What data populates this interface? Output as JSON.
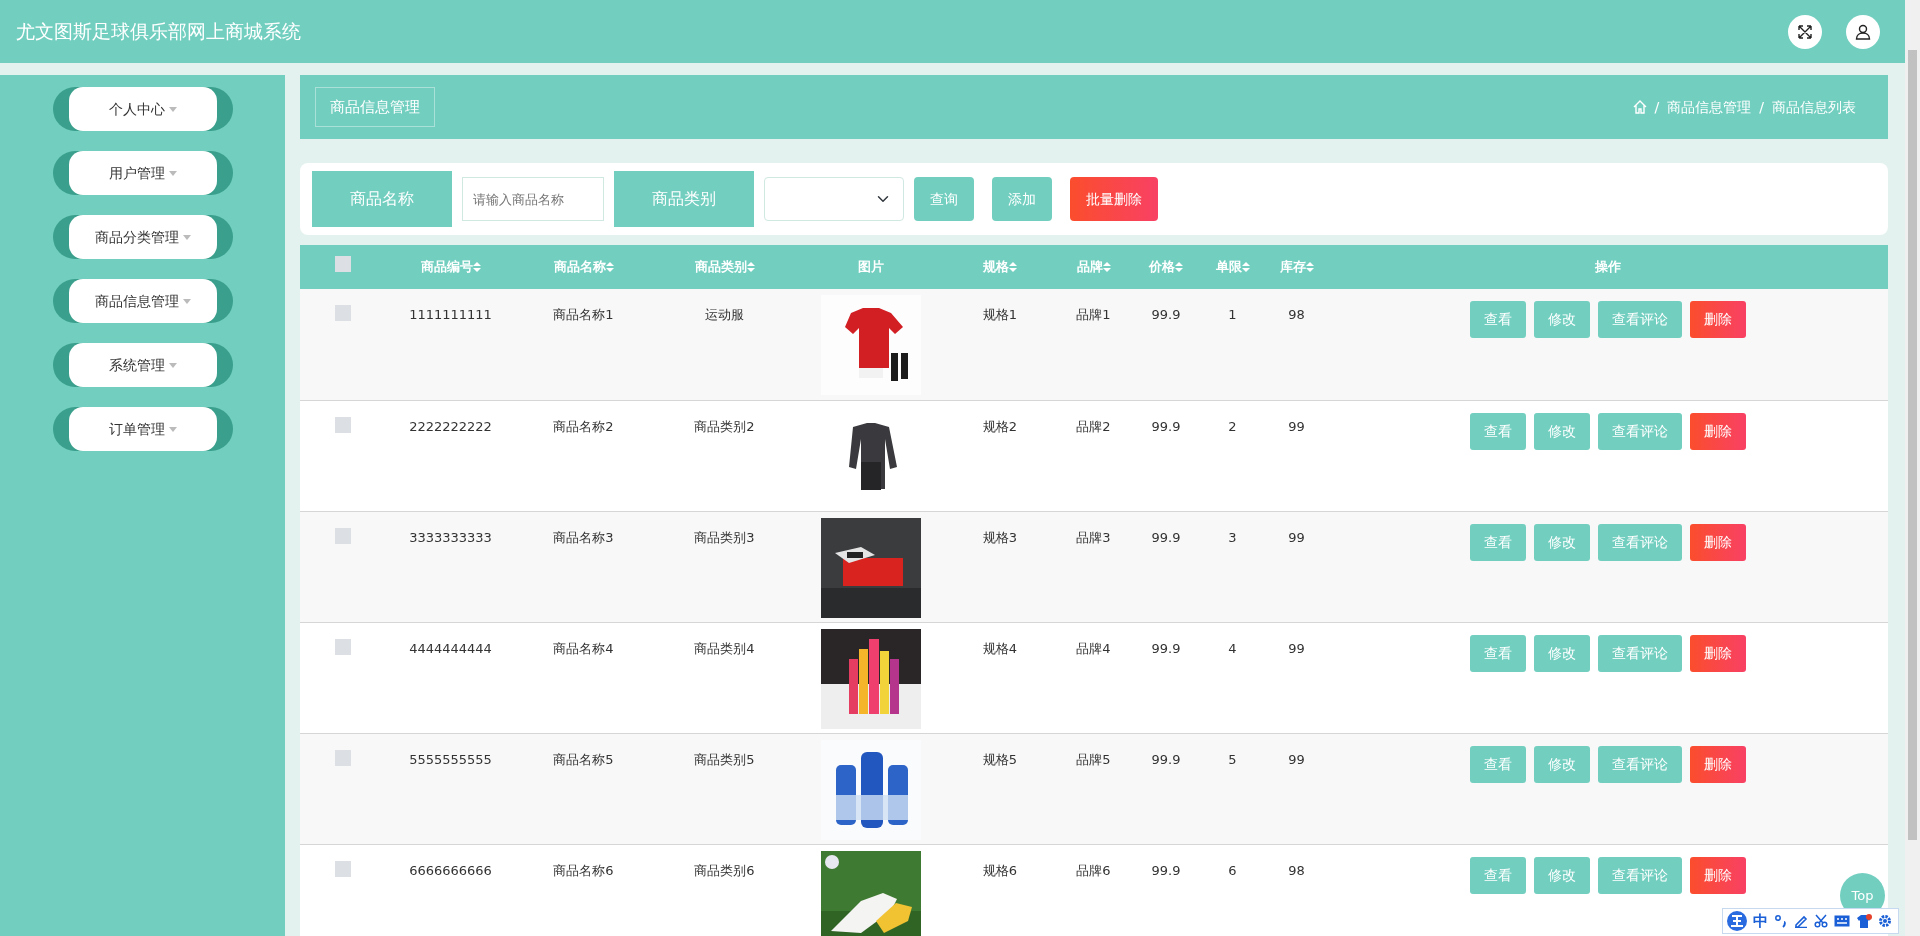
{
  "header": {
    "title": "尤文图斯足球俱乐部网上商城系统"
  },
  "sidebar": {
    "items": [
      {
        "label": "个人中心"
      },
      {
        "label": "用户管理"
      },
      {
        "label": "商品分类管理"
      },
      {
        "label": "商品信息管理"
      },
      {
        "label": "系统管理"
      },
      {
        "label": "订单管理"
      }
    ]
  },
  "page_title": "商品信息管理",
  "breadcrumb": [
    "/",
    "商品信息管理",
    "/",
    "商品信息列表"
  ],
  "search": {
    "fields": [
      {
        "label": "商品名称",
        "kind": "input",
        "placeholder": "请输入商品名称"
      },
      {
        "label": "商品类别",
        "kind": "select"
      }
    ],
    "buttons": [
      {
        "label": "查询",
        "kind": "plain"
      },
      {
        "label": "添加",
        "kind": "plain"
      },
      {
        "label": "批量删除",
        "kind": "danger"
      }
    ]
  },
  "table": {
    "select_all": {
      "checked": false
    },
    "columns": [
      {
        "label": "商品编号",
        "sortable": true
      },
      {
        "label": "商品名称",
        "sortable": true
      },
      {
        "label": "商品类别",
        "sortable": true
      },
      {
        "label": "图片",
        "sortable": false
      },
      {
        "label": "规格",
        "sortable": true
      },
      {
        "label": "品牌",
        "sortable": true
      },
      {
        "label": "价格",
        "sortable": true
      },
      {
        "label": "单限",
        "sortable": true
      },
      {
        "label": "库存",
        "sortable": true
      },
      {
        "label": "操作",
        "sortable": false
      }
    ],
    "rows": [
      {
        "checked": false,
        "cells": [
          "1111111111",
          "商品名称1",
          "运动服"
        ],
        "image": {
          "kind": "picture"
        },
        "cells2": [
          "规格1",
          "品牌1",
          "99.9",
          "1",
          "98"
        ],
        "actions": [
          {
            "label": "查看",
            "kind": "view"
          },
          {
            "label": "修改",
            "kind": "edit"
          },
          {
            "label": "查看评论",
            "kind": "comments"
          },
          {
            "label": "删除",
            "kind": "delete"
          }
        ]
      },
      {
        "checked": false,
        "cells": [
          "2222222222",
          "商品名称2",
          "商品类别2"
        ],
        "image": {
          "kind": "picture"
        },
        "cells2": [
          "规格2",
          "品牌2",
          "99.9",
          "2",
          "99"
        ],
        "actions": [
          {
            "label": "查看",
            "kind": "view"
          },
          {
            "label": "修改",
            "kind": "edit"
          },
          {
            "label": "查看评论",
            "kind": "comments"
          },
          {
            "label": "删除",
            "kind": "delete"
          }
        ]
      },
      {
        "checked": false,
        "cells": [
          "3333333333",
          "商品名称3",
          "商品类别3"
        ],
        "image": {
          "kind": "picture"
        },
        "cells2": [
          "规格3",
          "品牌3",
          "99.9",
          "3",
          "99"
        ],
        "actions": [
          {
            "label": "查看",
            "kind": "view"
          },
          {
            "label": "修改",
            "kind": "edit"
          },
          {
            "label": "查看评论",
            "kind": "comments"
          },
          {
            "label": "删除",
            "kind": "delete"
          }
        ]
      },
      {
        "checked": false,
        "cells": [
          "4444444444",
          "商品名称4",
          "商品类别4"
        ],
        "image": {
          "kind": "picture"
        },
        "cells2": [
          "规格4",
          "品牌4",
          "99.9",
          "4",
          "99"
        ],
        "actions": [
          {
            "label": "查看",
            "kind": "view"
          },
          {
            "label": "修改",
            "kind": "edit"
          },
          {
            "label": "查看评论",
            "kind": "comments"
          },
          {
            "label": "删除",
            "kind": "delete"
          }
        ]
      },
      {
        "checked": false,
        "cells": [
          "5555555555",
          "商品名称5",
          "商品类别5"
        ],
        "image": {
          "kind": "picture"
        },
        "cells2": [
          "规格5",
          "品牌5",
          "99.9",
          "5",
          "99"
        ],
        "actions": [
          {
            "label": "查看",
            "kind": "view"
          },
          {
            "label": "修改",
            "kind": "edit"
          },
          {
            "label": "查看评论",
            "kind": "comments"
          },
          {
            "label": "删除",
            "kind": "delete"
          }
        ]
      },
      {
        "checked": false,
        "cells": [
          "6666666666",
          "商品名称6",
          "商品类别6"
        ],
        "image": {
          "kind": "picture"
        },
        "cells2": [
          "规格6",
          "品牌6",
          "99.9",
          "6",
          "98"
        ],
        "actions": [
          {
            "label": "查看",
            "kind": "view"
          },
          {
            "label": "修改",
            "kind": "edit"
          },
          {
            "label": "查看评论",
            "kind": "comments"
          },
          {
            "label": "删除",
            "kind": "delete"
          }
        ]
      }
    ]
  },
  "top_button": "Top",
  "ime_toolbar": {
    "label": "中"
  }
}
